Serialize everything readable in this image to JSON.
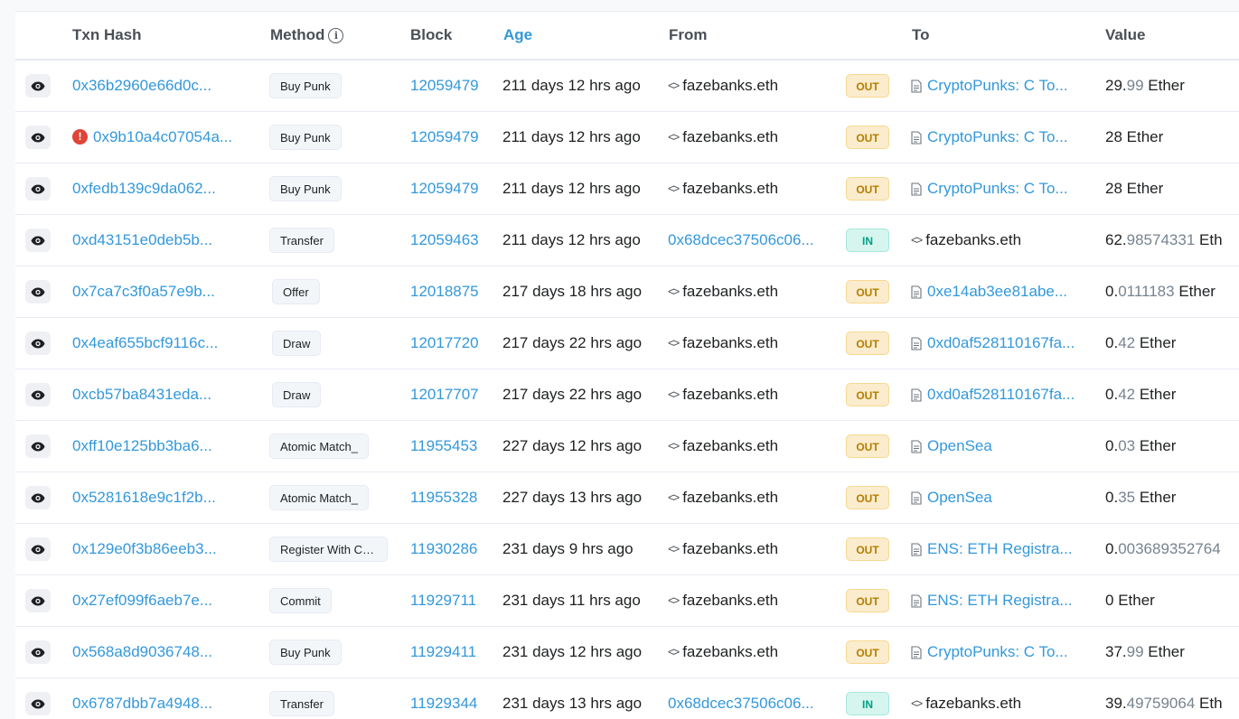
{
  "headers": {
    "txn_hash": "Txn Hash",
    "method": "Method",
    "block": "Block",
    "age": "Age",
    "from": "From",
    "to": "To",
    "value": "Value"
  },
  "colors": {
    "link": "#3498db",
    "out_badge": "#fbeccd",
    "in_badge": "#d7f5ef",
    "error": "#de4437"
  },
  "rows": [
    {
      "hash": "0x36b2960e66d0c...",
      "error": false,
      "method": "Buy Punk",
      "block": "12059479",
      "age": "211 days 12 hrs ago",
      "from": "fazebanks.eth",
      "from_type": "ens",
      "direction": "OUT",
      "to": "CryptoPunks: C To...",
      "to_type": "contract",
      "value_int": "29.",
      "value_frac": "99",
      "value_unit": " Ether"
    },
    {
      "hash": "0x9b10a4c07054a...",
      "error": true,
      "method": "Buy Punk",
      "block": "12059479",
      "age": "211 days 12 hrs ago",
      "from": "fazebanks.eth",
      "from_type": "ens",
      "direction": "OUT",
      "to": "CryptoPunks: C To...",
      "to_type": "contract",
      "value_int": "28",
      "value_frac": "",
      "value_unit": " Ether"
    },
    {
      "hash": "0xfedb139c9da062...",
      "error": false,
      "method": "Buy Punk",
      "block": "12059479",
      "age": "211 days 12 hrs ago",
      "from": "fazebanks.eth",
      "from_type": "ens",
      "direction": "OUT",
      "to": "CryptoPunks: C To...",
      "to_type": "contract",
      "value_int": "28",
      "value_frac": "",
      "value_unit": " Ether"
    },
    {
      "hash": "0xd43151e0deb5b...",
      "error": false,
      "method": "Transfer",
      "block": "12059463",
      "age": "211 days 12 hrs ago",
      "from": "0x68dcec37506c06...",
      "from_type": "address",
      "direction": "IN",
      "to": "fazebanks.eth",
      "to_type": "ens",
      "value_int": "62.",
      "value_frac": "98574331",
      "value_unit": " Eth"
    },
    {
      "hash": "0x7ca7c3f0a57e9b...",
      "error": false,
      "method": "Offer",
      "block": "12018875",
      "age": "217 days 18 hrs ago",
      "from": "fazebanks.eth",
      "from_type": "ens",
      "direction": "OUT",
      "to": "0xe14ab3ee81abe...",
      "to_type": "contract",
      "value_int": "0.",
      "value_frac": "0111183",
      "value_unit": " Ether"
    },
    {
      "hash": "0x4eaf655bcf9116c...",
      "error": false,
      "method": "Draw",
      "block": "12017720",
      "age": "217 days 22 hrs ago",
      "from": "fazebanks.eth",
      "from_type": "ens",
      "direction": "OUT",
      "to": "0xd0af528110167fa...",
      "to_type": "contract",
      "value_int": "0.",
      "value_frac": "42",
      "value_unit": " Ether"
    },
    {
      "hash": "0xcb57ba8431eda...",
      "error": false,
      "method": "Draw",
      "block": "12017707",
      "age": "217 days 22 hrs ago",
      "from": "fazebanks.eth",
      "from_type": "ens",
      "direction": "OUT",
      "to": "0xd0af528110167fa...",
      "to_type": "contract",
      "value_int": "0.",
      "value_frac": "42",
      "value_unit": " Ether"
    },
    {
      "hash": "0xff10e125bb3ba6...",
      "error": false,
      "method": "Atomic Match_",
      "block": "11955453",
      "age": "227 days 12 hrs ago",
      "from": "fazebanks.eth",
      "from_type": "ens",
      "direction": "OUT",
      "to": "OpenSea",
      "to_type": "contract",
      "value_int": "0.",
      "value_frac": "03",
      "value_unit": " Ether"
    },
    {
      "hash": "0x5281618e9c1f2b...",
      "error": false,
      "method": "Atomic Match_",
      "block": "11955328",
      "age": "227 days 13 hrs ago",
      "from": "fazebanks.eth",
      "from_type": "ens",
      "direction": "OUT",
      "to": "OpenSea",
      "to_type": "contract",
      "value_int": "0.",
      "value_frac": "35",
      "value_unit": " Ether"
    },
    {
      "hash": "0x129e0f3b86eeb3...",
      "error": false,
      "method": "Register With Co...",
      "block": "11930286",
      "age": "231 days 9 hrs ago",
      "from": "fazebanks.eth",
      "from_type": "ens",
      "direction": "OUT",
      "to": "ENS: ETH Registra...",
      "to_type": "contract",
      "value_int": "0.",
      "value_frac": "003689352764",
      "value_unit": ""
    },
    {
      "hash": "0x27ef099f6aeb7e...",
      "error": false,
      "method": "Commit",
      "block": "11929711",
      "age": "231 days 11 hrs ago",
      "from": "fazebanks.eth",
      "from_type": "ens",
      "direction": "OUT",
      "to": "ENS: ETH Registra...",
      "to_type": "contract",
      "value_int": "0",
      "value_frac": "",
      "value_unit": " Ether"
    },
    {
      "hash": "0x568a8d9036748...",
      "error": false,
      "method": "Buy Punk",
      "block": "11929411",
      "age": "231 days 12 hrs ago",
      "from": "fazebanks.eth",
      "from_type": "ens",
      "direction": "OUT",
      "to": "CryptoPunks: C To...",
      "to_type": "contract",
      "value_int": "37.",
      "value_frac": "99",
      "value_unit": " Ether"
    },
    {
      "hash": "0x6787dbb7a4948...",
      "error": false,
      "method": "Transfer",
      "block": "11929344",
      "age": "231 days 13 hrs ago",
      "from": "0x68dcec37506c06...",
      "from_type": "address",
      "direction": "IN",
      "to": "fazebanks.eth",
      "to_type": "ens",
      "value_int": "39.",
      "value_frac": "49759064",
      "value_unit": " Eth"
    }
  ]
}
